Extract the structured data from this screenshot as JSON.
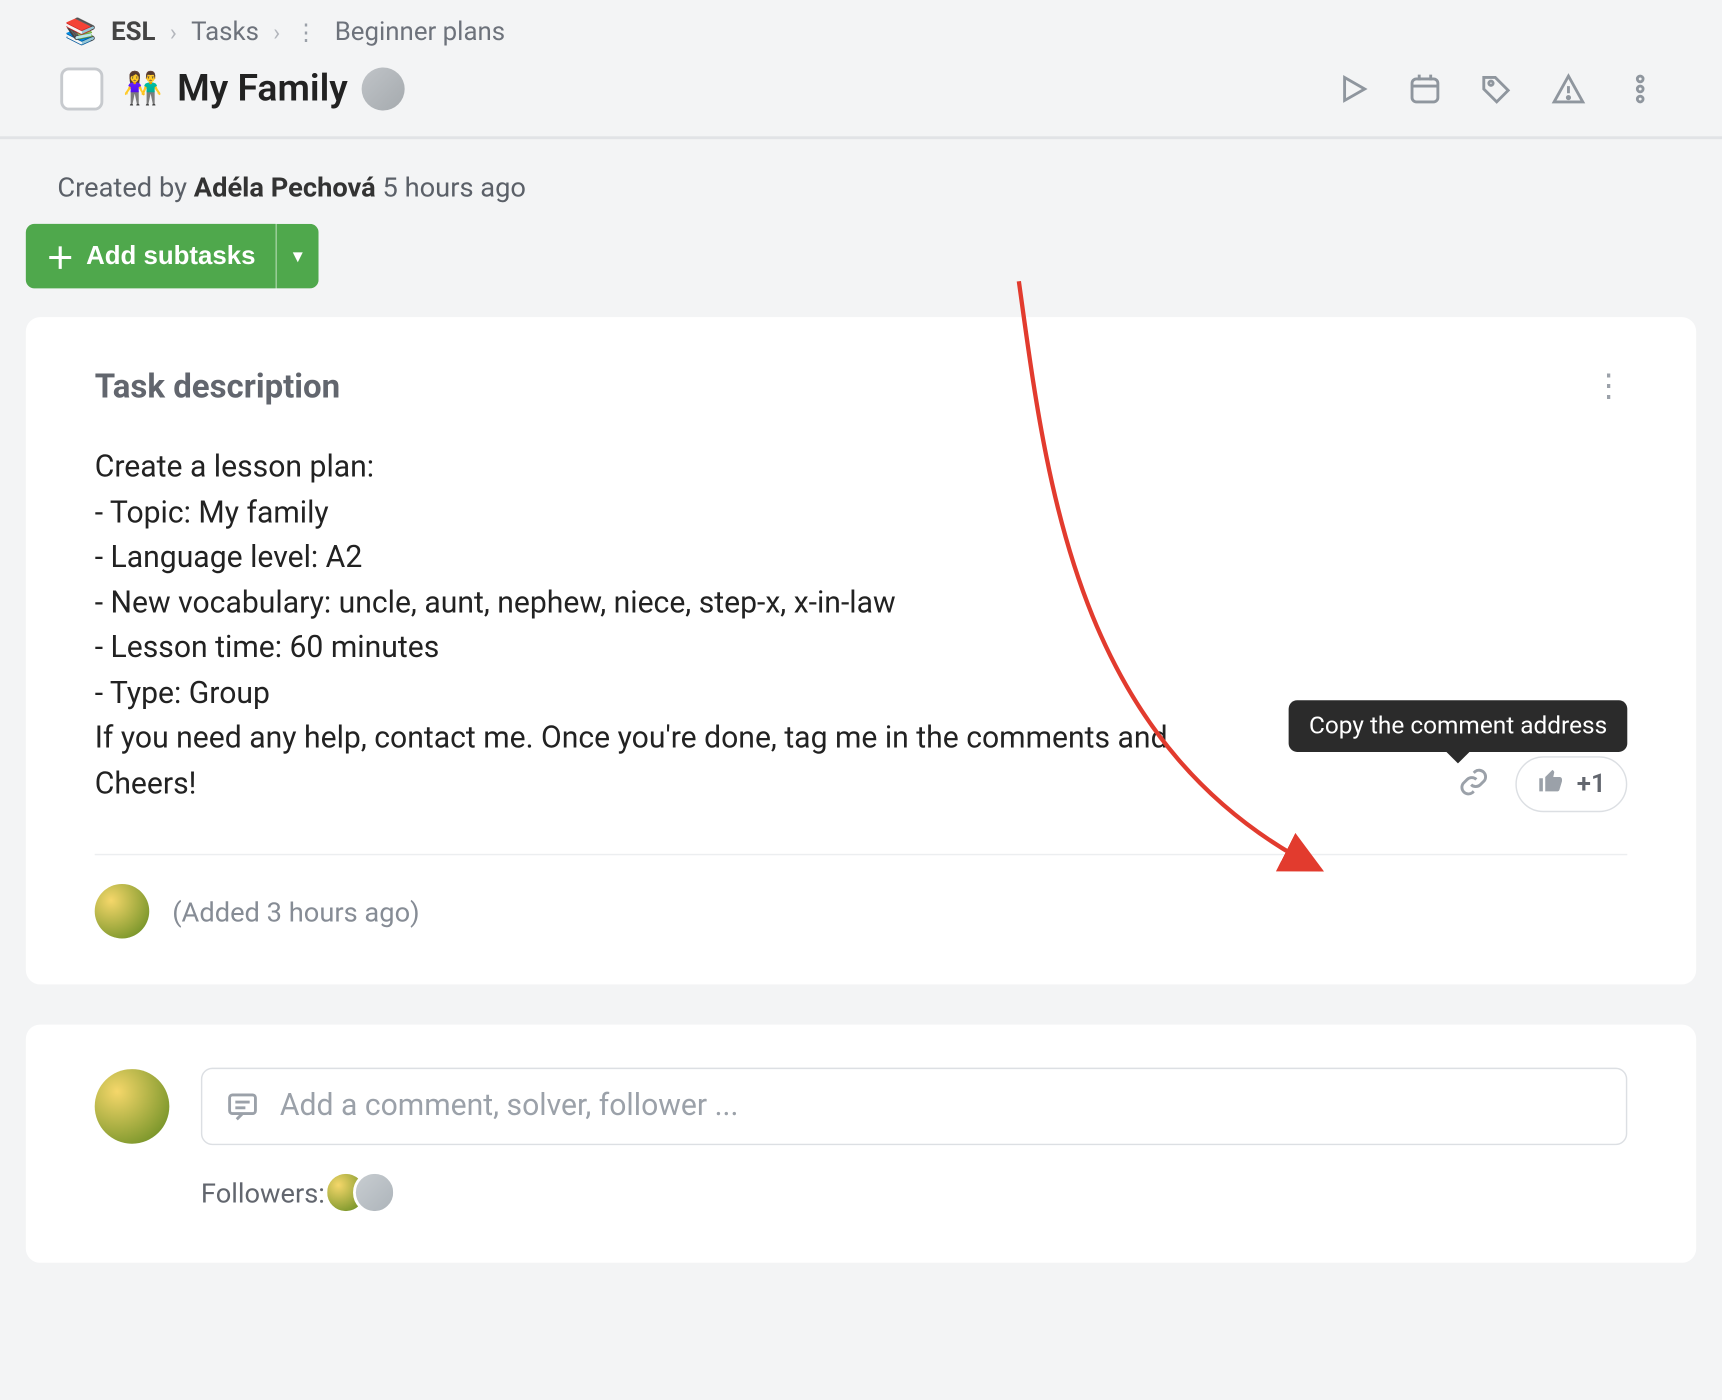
{
  "breadcrumb": {
    "icon": "📚",
    "root": "ESL",
    "mid": "Tasks",
    "leaf": "Beginner plans"
  },
  "task": {
    "emoji": "👫",
    "title": "My Family"
  },
  "meta": {
    "prefix": "Created by ",
    "author": "Adéla Pechová",
    "time": "5 hours ago"
  },
  "add_subtasks_label": "Add subtasks",
  "description": {
    "heading": "Task description",
    "lines": [
      "Create a lesson plan:",
      "- Topic: My family",
      "- Language level: A2",
      "- New vocabulary: uncle, aunt, nephew, niece, step-x, x-in-law",
      "- Lesson time: 60 minutes",
      "- Type: Group",
      "",
      "If you need any help, contact me. Once you're done, tag me in the comments and",
      "Cheers!"
    ],
    "added": "(Added 3 hours ago)"
  },
  "tooltip_text": "Copy the comment address",
  "plus_one_label": "+1",
  "comment_placeholder": "Add a comment, solver, follower ...",
  "followers_label": "Followers:"
}
